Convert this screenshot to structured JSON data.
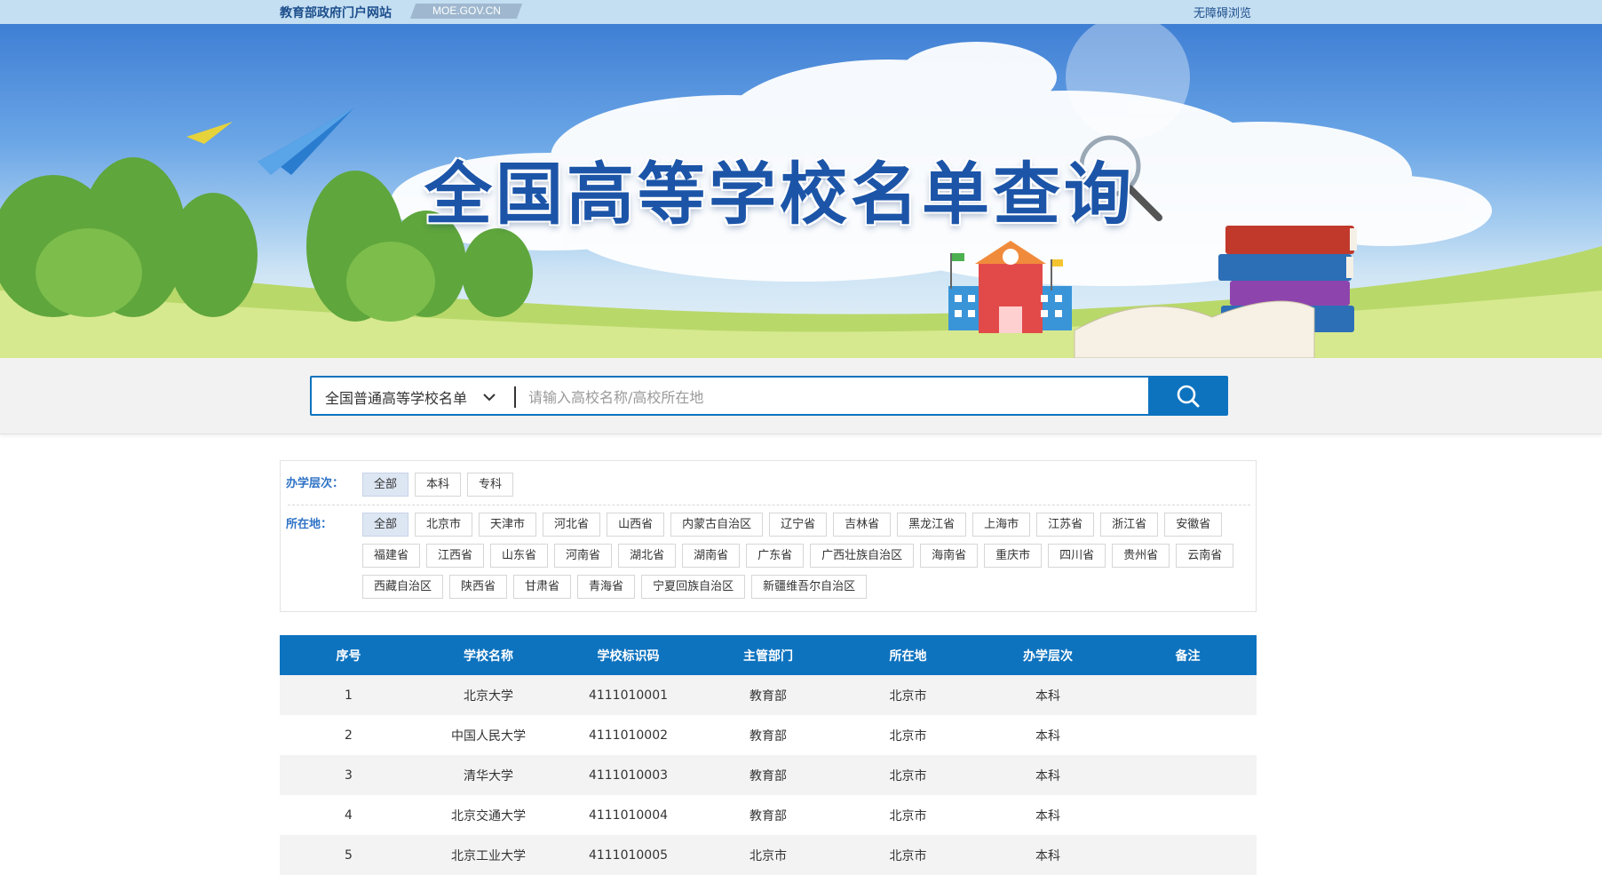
{
  "topbar": {
    "site_name": "教育部政府门户网站",
    "domain": "MOE.GOV.CN",
    "accessibility": "无障碍浏览"
  },
  "banner": {
    "title": "全国高等学校名单查询"
  },
  "search": {
    "scope": "全国普通高等学校名单",
    "placeholder": "请输入高校名称/高校所在地",
    "value": ""
  },
  "filters": {
    "level_label": "办学层次：",
    "levels": [
      "全部",
      "本科",
      "专科"
    ],
    "level_selected": "全部",
    "region_label": "所在地：",
    "regions": [
      "全部",
      "北京市",
      "天津市",
      "河北省",
      "山西省",
      "内蒙古自治区",
      "辽宁省",
      "吉林省",
      "黑龙江省",
      "上海市",
      "江苏省",
      "浙江省",
      "安徽省",
      "福建省",
      "江西省",
      "山东省",
      "河南省",
      "湖北省",
      "湖南省",
      "广东省",
      "广西壮族自治区",
      "海南省",
      "重庆市",
      "四川省",
      "贵州省",
      "云南省",
      "西藏自治区",
      "陕西省",
      "甘肃省",
      "青海省",
      "宁夏回族自治区",
      "新疆维吾尔自治区"
    ],
    "region_selected": "全部"
  },
  "table": {
    "columns": [
      "序号",
      "学校名称",
      "学校标识码",
      "主管部门",
      "所在地",
      "办学层次",
      "备注"
    ],
    "rows": [
      [
        "1",
        "北京大学",
        "4111010001",
        "教育部",
        "北京市",
        "本科",
        ""
      ],
      [
        "2",
        "中国人民大学",
        "4111010002",
        "教育部",
        "北京市",
        "本科",
        ""
      ],
      [
        "3",
        "清华大学",
        "4111010003",
        "教育部",
        "北京市",
        "本科",
        ""
      ],
      [
        "4",
        "北京交通大学",
        "4111010004",
        "教育部",
        "北京市",
        "本科",
        ""
      ],
      [
        "5",
        "北京工业大学",
        "4111010005",
        "北京市",
        "北京市",
        "本科",
        ""
      ]
    ]
  },
  "colors": {
    "primary": "#0e73bf",
    "topbar_bg": "#c4def2",
    "label_blue": "#2f73c6",
    "active_tag_bg": "#dde6f3"
  }
}
